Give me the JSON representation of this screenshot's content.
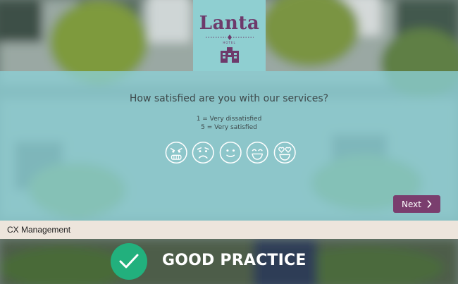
{
  "logo": {
    "name": "Lanta",
    "subtitle": "HOTEL",
    "icon": "hotel-building-icon"
  },
  "survey": {
    "question": "How satisfied are you with our services?",
    "scale_low": "1 = Very dissatisfied",
    "scale_high": "5 = Very satisfied",
    "faces": [
      "angry-face-icon",
      "sad-face-icon",
      "neutral-face-icon",
      "happy-face-icon",
      "heart-eyes-face-icon"
    ]
  },
  "navigation": {
    "next_label": "Next",
    "next_icon": "chevron-right-icon"
  },
  "footer": {
    "label": "CX Management"
  },
  "verdict": {
    "label": "GOOD PRACTICE",
    "icon": "checkmark-icon",
    "badge_color": "#22b07d"
  },
  "colors": {
    "brand": "#7a3e6e",
    "panel": "#8cd0d6",
    "footer_bg": "#ede5dc"
  }
}
